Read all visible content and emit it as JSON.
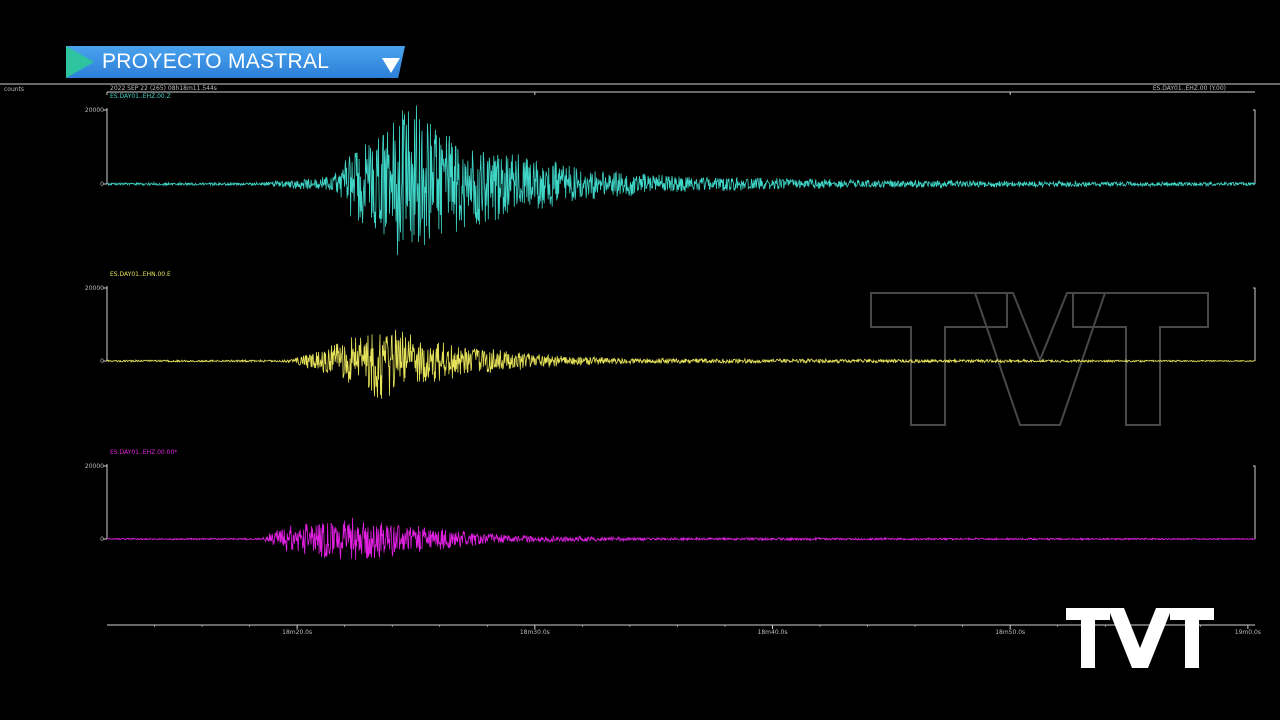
{
  "banner": {
    "title": "PROYECTO MASTRAL"
  },
  "header": {
    "units": "counts",
    "start_time": "2022 SEP 22 (265) 08h18m11.544s",
    "right_label": "ES.DAY01..EHZ.00 (Y.00)"
  },
  "watermark": "TVT",
  "logo": "TVT",
  "colors": {
    "channel1": "#3fd6c8",
    "channel2": "#e6e35a",
    "channel3": "#e021e0",
    "axis": "#cfcfcf"
  },
  "chart_data": {
    "type": "line",
    "xlabel": "",
    "x_tick_labels": [
      "18m20.0s",
      "18m30.0s",
      "18m40.0s",
      "18m50.0s",
      "19m0.0s"
    ],
    "xlim_seconds": [
      12.0,
      60.3
    ],
    "grid": false,
    "legend": "none",
    "series": [
      {
        "name": "ES.DAY01..EHZ.00.Z",
        "ytick_top": "20000",
        "ytick_zero": "0",
        "ylim": [
          -20000,
          20000
        ],
        "envelope": [
          [
            0,
            0.01
          ],
          [
            18.5,
            0.02
          ],
          [
            21.5,
            0.1
          ],
          [
            22.5,
            0.5
          ],
          [
            24.0,
            0.85
          ],
          [
            25.0,
            1.0
          ],
          [
            26.5,
            0.6
          ],
          [
            29.0,
            0.4
          ],
          [
            32.0,
            0.2
          ],
          [
            36.0,
            0.1
          ],
          [
            44.0,
            0.05
          ],
          [
            60.3,
            0.02
          ]
        ]
      },
      {
        "name": "ES.DAY01..EHN.00.E",
        "ytick_top": "20000",
        "ytick_zero": "0",
        "ylim": [
          -20000,
          20000
        ],
        "envelope": [
          [
            0,
            0.01
          ],
          [
            19.5,
            0.02
          ],
          [
            21.0,
            0.2
          ],
          [
            22.5,
            0.5
          ],
          [
            23.5,
            0.7
          ],
          [
            25.0,
            0.45
          ],
          [
            27.5,
            0.25
          ],
          [
            31.0,
            0.1
          ],
          [
            34.0,
            0.05
          ],
          [
            60.3,
            0.01
          ]
        ]
      },
      {
        "name": "ES.DAY01..EHZ.00.00*",
        "ytick_top": "20000",
        "ytick_zero": "0",
        "ylim": [
          -20000,
          20000
        ],
        "envelope": [
          [
            0,
            0.01
          ],
          [
            18.5,
            0.02
          ],
          [
            19.2,
            0.25
          ],
          [
            21.0,
            0.42
          ],
          [
            22.5,
            0.48
          ],
          [
            24.5,
            0.35
          ],
          [
            26.5,
            0.2
          ],
          [
            29.0,
            0.08
          ],
          [
            35.0,
            0.03
          ],
          [
            60.3,
            0.015
          ]
        ]
      }
    ]
  }
}
